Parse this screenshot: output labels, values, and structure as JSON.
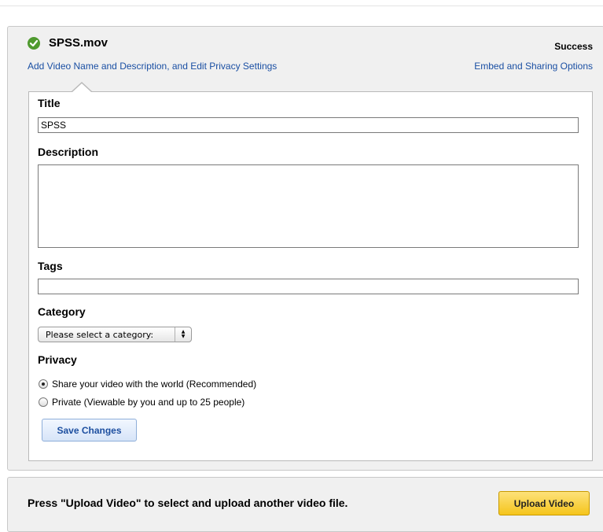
{
  "file": {
    "name": "SPSS.mov",
    "status": "Success",
    "status_icon": "check-icon",
    "status_color": "#4f9a2f"
  },
  "links": {
    "edit_details": "Add Video Name and Description, and Edit Privacy Settings",
    "embed_sharing": "Embed and Sharing Options"
  },
  "form": {
    "title_label": "Title",
    "title_value": "SPSS",
    "description_label": "Description",
    "description_value": "",
    "tags_label": "Tags",
    "tags_value": "",
    "category_label": "Category",
    "category_selected": "Please select a category:",
    "privacy_label": "Privacy",
    "privacy_options": [
      {
        "label": "Share your video with the world (Recommended)",
        "checked": true
      },
      {
        "label": "Private (Viewable by you and up to 25 people)",
        "checked": false
      }
    ],
    "save_label": "Save Changes"
  },
  "footer": {
    "prompt": "Press \"Upload Video\" to select and upload another video file.",
    "upload_label": "Upload Video",
    "upload_color": "#f5c51c"
  }
}
